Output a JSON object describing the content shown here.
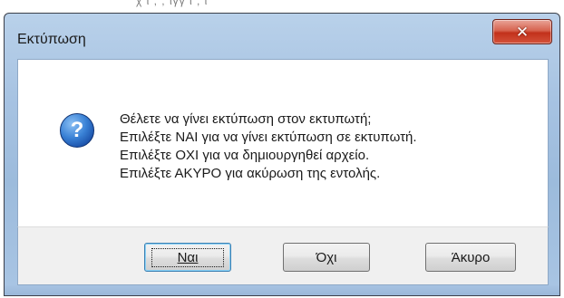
{
  "background": {
    "partial_text": "χ   ι   ,   ,   ιγγ    ι   ,   ι"
  },
  "window": {
    "title": "Εκτύπωση",
    "close_glyph": "✕",
    "close_icon": "close-icon"
  },
  "message": {
    "icon": "question-icon",
    "icon_glyph": "?",
    "lines": [
      "Θέλετε να γίνει εκτύπωση στον εκτυπωτή;",
      "Επιλέξτε ΝΑΙ για να γίνει εκτύπωση σε εκτυπωτή.",
      "Επιλέξτε ΟΧΙ για να δημιουργηθεί αρχείο.",
      "Επιλέξτε ΑΚΥΡΟ για ακύρωση της εντολής."
    ]
  },
  "buttons": {
    "yes_label": "Ναι",
    "no_label": "Όχι",
    "cancel_label": "Άκυρο"
  },
  "colors": {
    "frame": "#a7c3e2",
    "close_button": "#c2311b",
    "question_icon": "#3a82d6",
    "default_button_border": "#3c7fb1"
  }
}
